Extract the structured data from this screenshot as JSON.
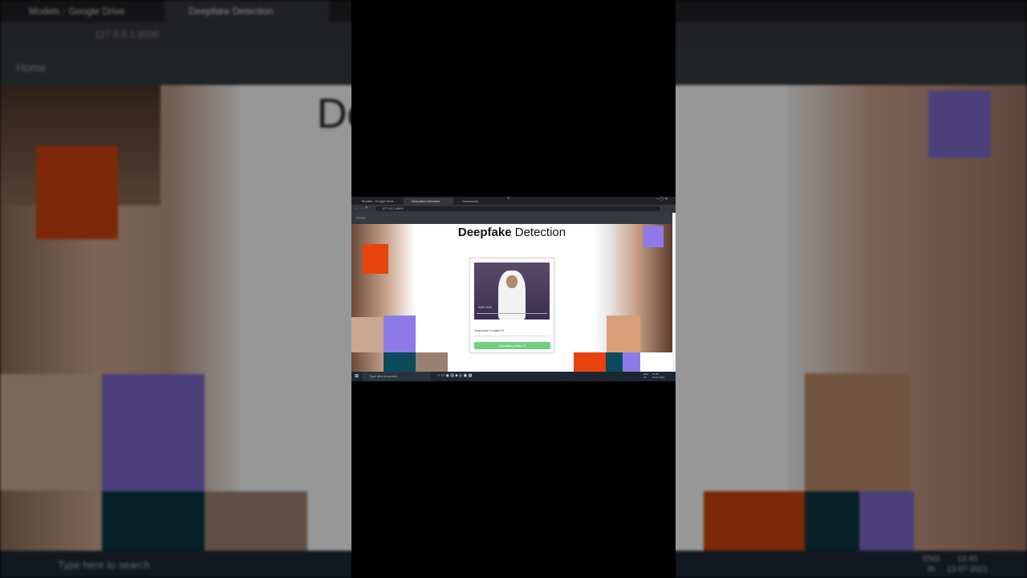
{
  "browser": {
    "tabs": [
      {
        "label": "Models - Google Drive"
      },
      {
        "label": "Deepfake Detection"
      },
      {
        "label": "Downloads"
      }
    ],
    "url": "127.0.0.1:8000"
  },
  "navbar": {
    "home_label": "Home"
  },
  "page": {
    "title_bold": "Deepfake",
    "title_light": "Detection",
    "video_time": "0:03 / 0:15",
    "sequence_label": "Sequence Length:20",
    "sequence_value": 20,
    "upload_button": "Uploading Video"
  },
  "taskbar": {
    "search_placeholder": "Type here to search",
    "lang": "ENG",
    "region": "IN",
    "time": "12:45",
    "date": "13-07-2021"
  },
  "colors": {
    "orange": "#e8430f",
    "purple": "#8f7be8",
    "teal": "#0d4a5c",
    "green": "#6fcf7f"
  }
}
